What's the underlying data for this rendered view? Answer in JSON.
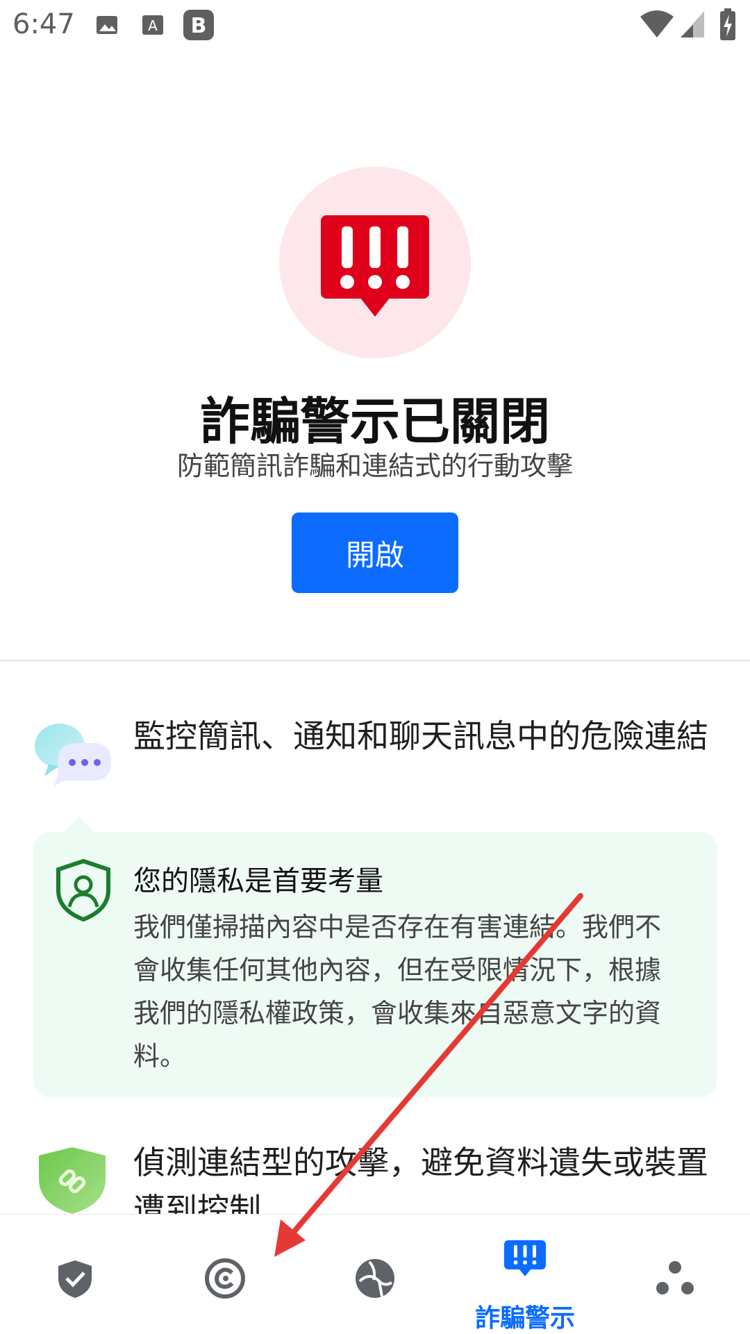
{
  "status_bar": {
    "time": "6:47",
    "left_icons": [
      "image-icon",
      "a-icon",
      "b-icon"
    ],
    "right_icons": [
      "wifi-icon",
      "signal-icon",
      "battery-charging-icon"
    ]
  },
  "hero": {
    "icon": "alert-message-icon",
    "title": "詐騙警示已關閉",
    "subtitle": "防範簡訊詐騙和連結式的行動攻擊",
    "button_label": "開啟"
  },
  "features": [
    {
      "icon": "chat-bubbles-icon",
      "text": "監控簡訊、通知和聊天訊息中的危險連結"
    },
    {
      "icon": "link-shield-icon",
      "text": "偵測連結型的攻擊，避免資料遺失或裝置遭到控制"
    }
  ],
  "privacy": {
    "icon": "user-shield-icon",
    "title": "您的隱私是首要考量",
    "body": "我們僅掃描內容中是否存在有害連結。我們不會收集任何其他內容，但在受限情況下，根據我們的隱私權政策，會收集來自惡意文字的資料。"
  },
  "bottom_nav": {
    "items": [
      {
        "icon": "shield-check-icon",
        "active": false
      },
      {
        "icon": "c-circle-icon",
        "active": false
      },
      {
        "icon": "ball-icon",
        "active": false
      },
      {
        "icon": "alert-message-icon",
        "active": true,
        "label": "詐騙警示"
      },
      {
        "icon": "dots-icon",
        "active": false
      }
    ]
  },
  "colors": {
    "accent": "#0b6cff",
    "alert_red": "#e0001b",
    "hero_bg": "#fde7ea",
    "privacy_bg": "#eefbf4",
    "nav_gray": "#5f6368",
    "annotation_red": "#e53935"
  }
}
